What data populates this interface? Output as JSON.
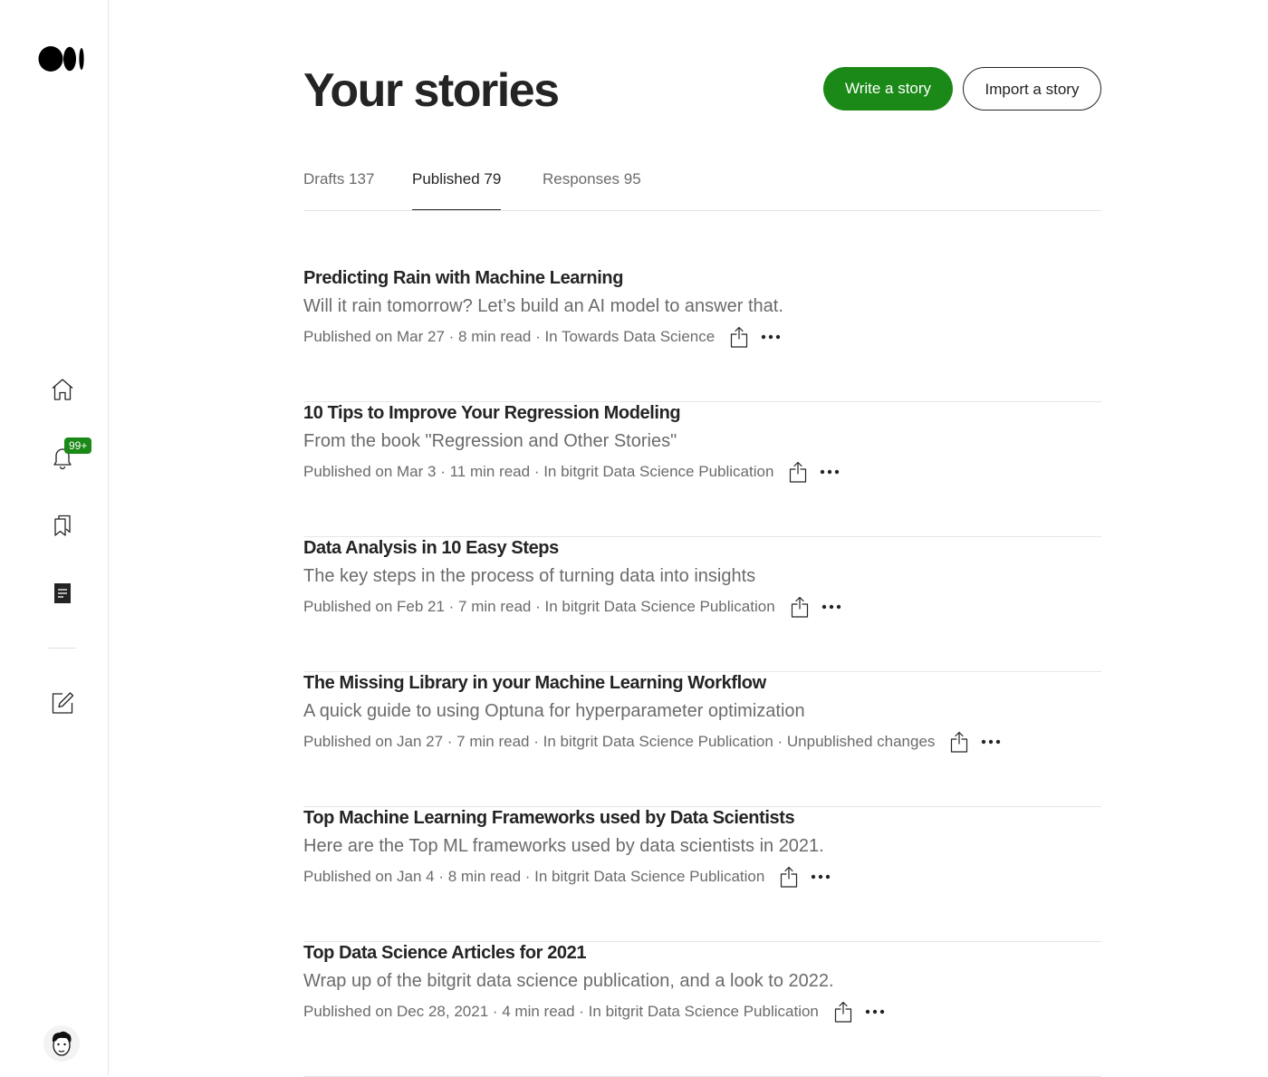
{
  "app": {
    "logo_icon": "medium-logo-icon"
  },
  "sidebar": {
    "items": [
      {
        "name": "home",
        "icon": "home-icon"
      },
      {
        "name": "notifications",
        "icon": "bell-icon",
        "badge": "99+"
      },
      {
        "name": "lists",
        "icon": "bookmarks-icon"
      },
      {
        "name": "stories",
        "icon": "stories-icon"
      },
      {
        "name": "write",
        "icon": "write-icon"
      }
    ],
    "badge_color": "#1a8917"
  },
  "header": {
    "title": "Your stories",
    "write_label": "Write a story",
    "import_label": "Import a story"
  },
  "tabs": [
    {
      "label": "Drafts 137",
      "active": false
    },
    {
      "label": "Published 79",
      "active": true
    },
    {
      "label": "Responses 95",
      "active": false
    }
  ],
  "stories": [
    {
      "title": "Predicting Rain with Machine Learning",
      "subtitle": "Will it rain tomorrow? Let’s build an AI model to answer that.",
      "meta": "Published on Mar 27 · 8 min read · In Towards Data Science"
    },
    {
      "title": "10 Tips to Improve Your Regression Modeling",
      "subtitle": "From the book \"Regression and Other Stories\"",
      "meta": "Published on Mar 3 · 11 min read · In bitgrit Data Science Publication"
    },
    {
      "title": "Data Analysis in 10 Easy Steps",
      "subtitle": "The key steps in the process of turning data into insights",
      "meta": "Published on Feb 21 · 7 min read · In bitgrit Data Science Publication"
    },
    {
      "title": "The Missing Library in your Machine Learning Workflow",
      "subtitle": "A quick guide to using Optuna for hyperparameter optimization",
      "meta": "Published on Jan 27 · 7 min read · In bitgrit Data Science Publication · Unpublished changes"
    },
    {
      "title": "Top Machine Learning Frameworks used by Data Scientists",
      "subtitle": "Here are the Top ML frameworks used by data scientists in 2021.",
      "meta": "Published on Jan 4 · 8 min read · In bitgrit Data Science Publication"
    },
    {
      "title": "Top Data Science Articles for 2021",
      "subtitle": "Wrap up of the bitgrit data science publication, and a look to 2022.",
      "meta": "Published on Dec 28, 2021 · 4 min read · In bitgrit Data Science Publication"
    }
  ],
  "colors": {
    "accent": "#1a8917",
    "text": "#242424",
    "muted": "#6b6b6b"
  }
}
